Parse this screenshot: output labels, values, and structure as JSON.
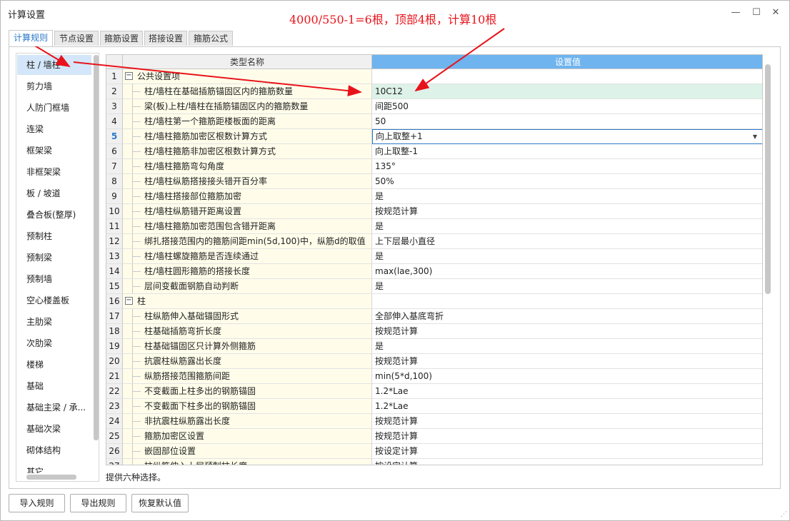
{
  "window": {
    "title": "计算设置",
    "annotation": "4000/550-1=6根，顶部4根，计算10根",
    "controls": {
      "minimize": "—",
      "maximize": "☐",
      "close": "✕"
    }
  },
  "tabs": [
    "计算规则",
    "节点设置",
    "箍筋设置",
    "搭接设置",
    "箍筋公式"
  ],
  "active_tab": 0,
  "sidebar": {
    "items": [
      "柱 / 墙柱",
      "剪力墙",
      "人防门框墙",
      "连梁",
      "框架梁",
      "非框架梁",
      "板 / 坡道",
      "叠合板(整厚)",
      "预制柱",
      "预制梁",
      "预制墙",
      "空心楼盖板",
      "主肋梁",
      "次肋梁",
      "楼梯",
      "基础",
      "基础主梁 / 承...",
      "基础次梁",
      "砌体结构",
      "其它"
    ],
    "active": 0
  },
  "grid": {
    "headers": {
      "num": "",
      "name": "类型名称",
      "value": "设置值"
    },
    "rows": [
      {
        "num": "1",
        "name": "公共设置项",
        "value": "",
        "group": true
      },
      {
        "num": "2",
        "name": "柱/墙柱在基础插筋锚固区内的箍筋数量",
        "value": "10C12",
        "highlight": true
      },
      {
        "num": "3",
        "name": "梁(板)上柱/墙柱在插筋锚固区内的箍筋数量",
        "value": "间距500"
      },
      {
        "num": "4",
        "name": "柱/墙柱第一个箍筋距楼板面的距离",
        "value": "50"
      },
      {
        "num": "5",
        "name": "柱/墙柱箍筋加密区根数计算方式",
        "value": "向上取整+1",
        "selected": true
      },
      {
        "num": "6",
        "name": "柱/墙柱箍筋非加密区根数计算方式",
        "value": "向上取整-1"
      },
      {
        "num": "7",
        "name": "柱/墙柱箍筋弯勾角度",
        "value": "135°"
      },
      {
        "num": "8",
        "name": "柱/墙柱纵筋搭接接头错开百分率",
        "value": "50%"
      },
      {
        "num": "9",
        "name": "柱/墙柱搭接部位箍筋加密",
        "value": "是"
      },
      {
        "num": "10",
        "name": "柱/墙柱纵筋错开距离设置",
        "value": "按规范计算"
      },
      {
        "num": "11",
        "name": "柱/墙柱箍筋加密范围包含错开距离",
        "value": "是"
      },
      {
        "num": "12",
        "name": "绑扎搭接范围内的箍筋间距min(5d,100)中，纵筋d的取值",
        "value": "上下层最小直径"
      },
      {
        "num": "13",
        "name": "柱/墙柱螺旋箍筋是否连续通过",
        "value": "是"
      },
      {
        "num": "14",
        "name": "柱/墙柱圆形箍筋的搭接长度",
        "value": "max(lae,300)"
      },
      {
        "num": "15",
        "name": "层间变截面钢筋自动判断",
        "value": "是"
      },
      {
        "num": "16",
        "name": "柱",
        "value": "",
        "group": true
      },
      {
        "num": "17",
        "name": "柱纵筋伸入基础锚固形式",
        "value": "全部伸入基底弯折"
      },
      {
        "num": "18",
        "name": "柱基础插筋弯折长度",
        "value": "按规范计算"
      },
      {
        "num": "19",
        "name": "柱基础锚固区只计算外侧箍筋",
        "value": "是"
      },
      {
        "num": "20",
        "name": "抗震柱纵筋露出长度",
        "value": "按规范计算"
      },
      {
        "num": "21",
        "name": "纵筋搭接范围箍筋间距",
        "value": "min(5*d,100)"
      },
      {
        "num": "22",
        "name": "不变截面上柱多出的钢筋锚固",
        "value": "1.2*Lae"
      },
      {
        "num": "23",
        "name": "不变截面下柱多出的钢筋锚固",
        "value": "1.2*Lae"
      },
      {
        "num": "24",
        "name": "非抗震柱纵筋露出长度",
        "value": "按规范计算"
      },
      {
        "num": "25",
        "name": "箍筋加密区设置",
        "value": "按规范计算"
      },
      {
        "num": "26",
        "name": "嵌固部位设置",
        "value": "按设定计算"
      },
      {
        "num": "27",
        "name": "柱纵筋伸入上层预制柱长度",
        "value": "按设定计算"
      }
    ]
  },
  "status_text": "提供六种选择。",
  "buttons": {
    "import": "导入规则",
    "export": "导出规则",
    "restore": "恢复默认值"
  },
  "colors": {
    "accent": "#2a78c8",
    "header_value_bg": "#6fb4ee",
    "annotation": "#e8131a",
    "highlight_row": "#ddf2e8",
    "name_column_bg": "#fffdea"
  }
}
